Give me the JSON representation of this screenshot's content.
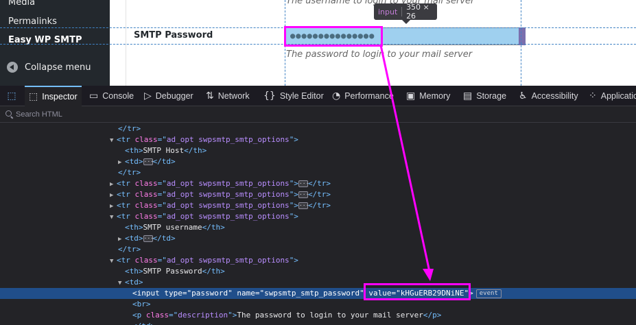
{
  "wp_sidebar": {
    "items": [
      "Media",
      "Permalinks",
      "Easy WP SMTP"
    ],
    "collapse_label": "Collapse menu"
  },
  "form": {
    "field_label": "SMTP Password",
    "username_description": "The username to login to your mail server",
    "password_description": "The password to login to your mail server",
    "password_dots": "●●●●●●●●●●●●●●●"
  },
  "infobar": {
    "tag": "input",
    "dims": "350 × 26"
  },
  "devtools": {
    "tabs": [
      {
        "label": "Inspector",
        "icon": "inspector-icon"
      },
      {
        "label": "Console",
        "icon": "console-icon"
      },
      {
        "label": "Debugger",
        "icon": "debugger-icon"
      },
      {
        "label": "Network",
        "icon": "network-icon"
      },
      {
        "label": "Style Editor",
        "icon": "style-editor-icon"
      },
      {
        "label": "Performance",
        "icon": "performance-icon"
      },
      {
        "label": "Memory",
        "icon": "memory-icon"
      },
      {
        "label": "Storage",
        "icon": "storage-icon"
      },
      {
        "label": "Accessibility",
        "icon": "accessibility-icon"
      },
      {
        "label": "Applicatio",
        "icon": "application-icon"
      }
    ],
    "search_placeholder": "Search HTML",
    "event_badge": "event"
  },
  "markup": {
    "tr_close": "</tr>",
    "tr_open_class": "ad_opt swpsmtp_smtp_options",
    "th_host": "SMTP Host",
    "th_username": "SMTP username",
    "th_password": "SMTP Password",
    "input_type": "password",
    "input_name": "swpsmtp_smtp_password",
    "input_value": "kHGuERB29DNiNE",
    "p_class": "description",
    "p_text": "The password to login to your mail server"
  },
  "colors": {
    "highlight": "#ff00ff",
    "selection": "#204e8a",
    "accent": "#75bfff"
  }
}
